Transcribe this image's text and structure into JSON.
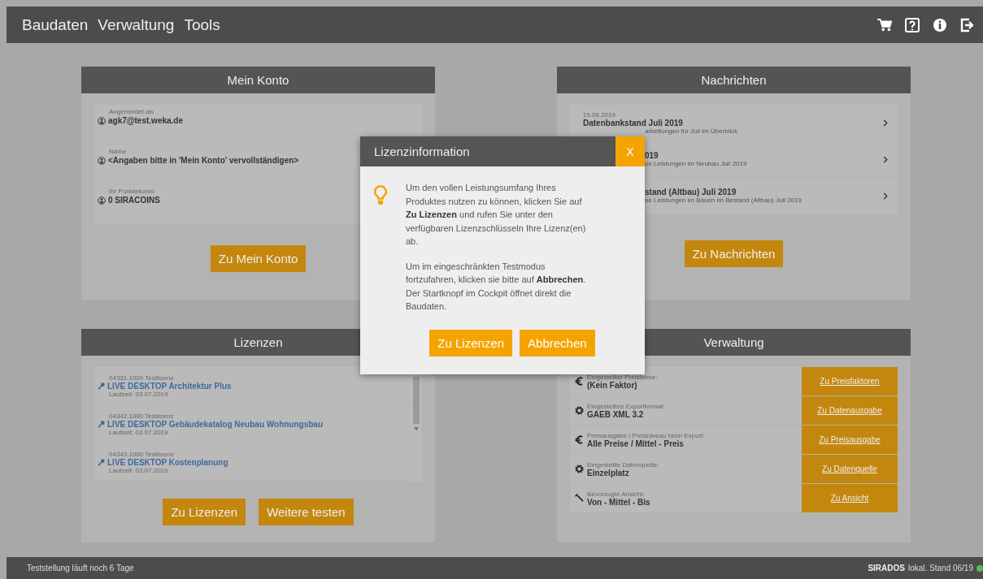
{
  "menu": [
    {
      "label": "Baudaten"
    },
    {
      "label": "Verwaltung"
    },
    {
      "label": "Tools"
    }
  ],
  "account": {
    "title": "Mein Konto",
    "rows": [
      {
        "label": "Angemeldet als",
        "value": "agk7@test.weka.de"
      },
      {
        "label": "Name",
        "value": "<Angaben bitte in 'Mein Konto' vervollständigen>"
      },
      {
        "label": "Ihr Punktekonto",
        "value": "0 SIRACOINS"
      }
    ],
    "button": "Zu Mein Konto"
  },
  "news": {
    "title": "Nachrichten",
    "items": [
      {
        "lines": [
          {
            "kind": "date",
            "text": "15.06.2019"
          },
          {
            "kind": "title",
            "text": "Datenbankstand Juli 2019"
          },
          {
            "kind": "summarytail",
            "text": "arbeitungen für Juli im Überblick"
          }
        ]
      },
      {
        "lines": [
          {
            "kind": "titletail",
            "text": "019"
          },
          {
            "kind": "summarytail",
            "text": "ue Leistungen im Neubau Juli 2019"
          }
        ]
      },
      {
        "lines": [
          {
            "kind": "titletail",
            "text": "stand (Altbau) Juli 2019"
          },
          {
            "kind": "summarytail",
            "text": "ue Leistungen im Bauen im Bestand (Altbau) Juli 2019"
          }
        ]
      }
    ],
    "button": "Zu Nachrichten"
  },
  "licenses": {
    "title": "Lizenzen",
    "items": [
      {
        "code": "04331.1000 Testlizenz",
        "name": "LIVE DESKTOP Architektur Plus",
        "runtime": "Laufzeit: 03.07.2019"
      },
      {
        "code": "04342.1000 Testlizenz",
        "name": "LIVE DESKTOP Gebäudekatalog Neubau Wohnungsbau",
        "runtime": "Laufzeit: 03.07.2019"
      },
      {
        "code": "04343.1000 Testlizenz",
        "name": "LIVE DESKTOP Kostenplanung",
        "runtime": "Laufzeit: 03.07.2019"
      }
    ],
    "buttons": [
      "Zu Lizenzen",
      "Weitere testen"
    ]
  },
  "admin": {
    "title": "Verwaltung",
    "rows": [
      {
        "kind": "euro",
        "label": "Eingestellter Preisfaktor:",
        "value": "(Kein Faktor)",
        "link": "Zu Preisfaktoren"
      },
      {
        "kind": "gear",
        "label": "Eingestelltes Exportformat:",
        "value": "GAEB XML 3.2",
        "link": "Zu Datenausgabe"
      },
      {
        "kind": "euro",
        "label": "Preisausgabe / Preisniveau beim Export:",
        "value": "Alle Preise / Mittel - Preis",
        "link": "Zu Preisausgabe"
      },
      {
        "kind": "gear",
        "label": "Eingestellte Datenquelle:",
        "value": "Einzelplatz",
        "link": "Zu Datenquelle"
      },
      {
        "kind": "wrench",
        "label": "Bevorzugte Ansicht:",
        "value": "Von - Mittel - Bis",
        "link": "Zu Ansicht"
      }
    ]
  },
  "dialog": {
    "title": "Lizenzinformation",
    "close": "X",
    "paragraphs": [
      "Um den vollen Leistungsumfang Ihres Produktes nutzen zu können, klicken Sie auf **Zu Lizenzen** und rufen Sie unter den verfügbaren Lizenzschlüsseln Ihre Lizenz(en) ab.",
      "Um im eingeschränkten Testmodus fortzufahren, klicken sie bitte auf **Abbrechen**. Der Startknopf im Cockpit öffnet direkt die Baudaten."
    ],
    "buttons": [
      "Zu Lizenzen",
      "Abbrechen"
    ]
  },
  "status_bar": {
    "left": "Teststellung läuft noch 6 Tage",
    "brand": "SIRADOS",
    "right": "lokal. Stand 06/19",
    "online": true
  }
}
